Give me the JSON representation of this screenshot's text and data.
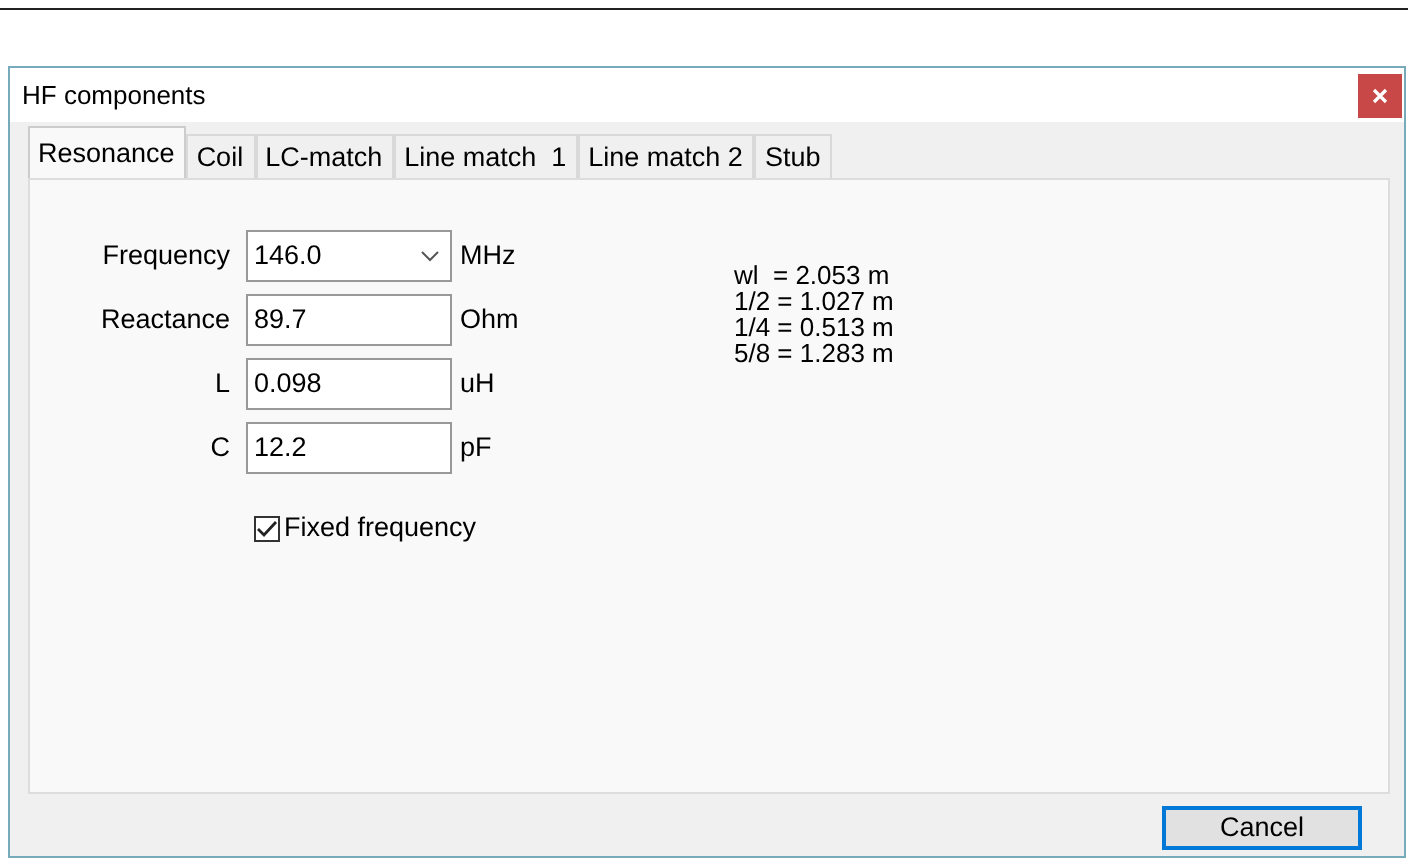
{
  "window": {
    "title": "HF components"
  },
  "tabs": [
    {
      "label": "Resonance",
      "selected": true
    },
    {
      "label": "Coil",
      "selected": false
    },
    {
      "label": "LC-match",
      "selected": false
    },
    {
      "label": "Line match  1",
      "selected": false
    },
    {
      "label": "Line match 2",
      "selected": false
    },
    {
      "label": "Stub",
      "selected": false
    }
  ],
  "fields": [
    {
      "label": "Frequency",
      "value": "146.0",
      "unit": "MHz",
      "kind": "dropdown"
    },
    {
      "label": "Reactance",
      "value": "89.7",
      "unit": "Ohm",
      "kind": "text"
    },
    {
      "label": "L",
      "value": "0.098",
      "unit": "uH",
      "kind": "text"
    },
    {
      "label": "C",
      "value": "12.2",
      "unit": "pF",
      "kind": "text"
    }
  ],
  "fixed_frequency": {
    "label": "Fixed frequency",
    "checked": true
  },
  "results": [
    "wl  = 2.053 m",
    "1/2 = 1.027 m",
    "1/4 = 0.513 m",
    "5/8 = 1.283 m"
  ],
  "buttons": [
    "Cancel"
  ]
}
